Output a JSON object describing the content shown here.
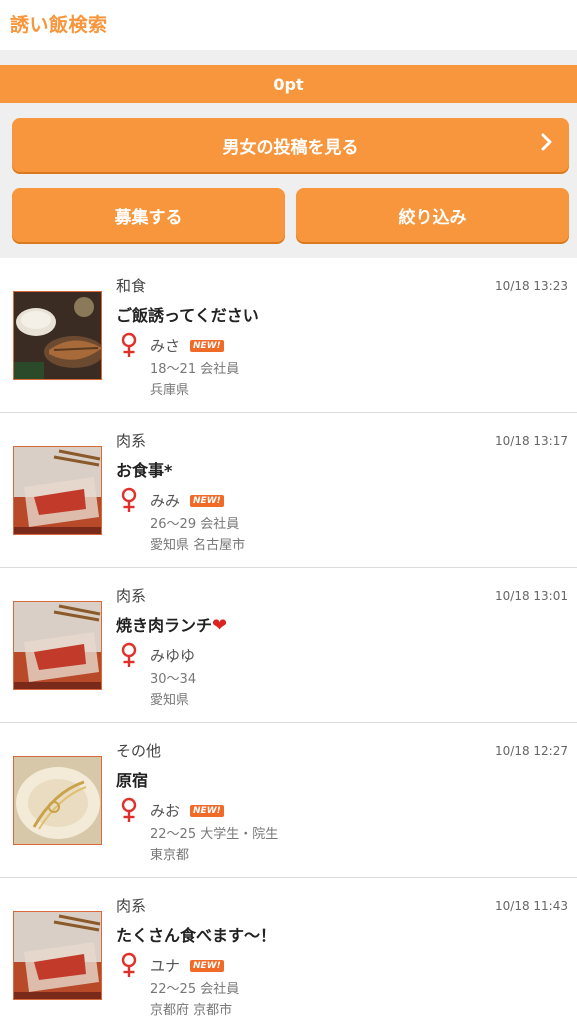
{
  "header": {
    "title": "誘い飯検索"
  },
  "points": {
    "value": "0pt"
  },
  "buttons": {
    "view_posts": "男女の投稿を見る",
    "recruit": "募集する",
    "filter": "絞り込み"
  },
  "new_badge": "NEW!",
  "posts": [
    {
      "category": "和食",
      "time": "10/18 13:23",
      "title": "ご飯誘ってください",
      "heart": "",
      "name": "みさ",
      "is_new": true,
      "detail": "18〜21 会社員",
      "area": "兵庫県",
      "thumb": "fish"
    },
    {
      "category": "肉系",
      "time": "10/18 13:17",
      "title": "お食事*",
      "heart": "",
      "name": "みみ",
      "is_new": true,
      "detail": "26〜29 会社員",
      "area": "愛知県 名古屋市",
      "thumb": "meat"
    },
    {
      "category": "肉系",
      "time": "10/18 13:01",
      "title": "焼き肉ランチ",
      "heart": "❤",
      "name": "みゆゆ",
      "is_new": false,
      "detail": "30〜34",
      "area": "愛知県",
      "thumb": "meat"
    },
    {
      "category": "その他",
      "time": "10/18 12:27",
      "title": "原宿",
      "heart": "",
      "name": "みお",
      "is_new": true,
      "detail": "22〜25 大学生・院生",
      "area": "東京都",
      "thumb": "plate"
    },
    {
      "category": "肉系",
      "time": "10/18 11:43",
      "title": "たくさん食べます〜！",
      "heart": "",
      "name": "ユナ",
      "is_new": true,
      "detail": "22〜25 会社員",
      "area": "京都府 京都市",
      "thumb": "meat"
    }
  ],
  "colors": {
    "accent": "#f7963c",
    "female": "#e0302a",
    "new_badge": "#f06a28"
  },
  "icons": {
    "gender": "female-symbol-icon",
    "chevron": "chevron-right-icon"
  }
}
